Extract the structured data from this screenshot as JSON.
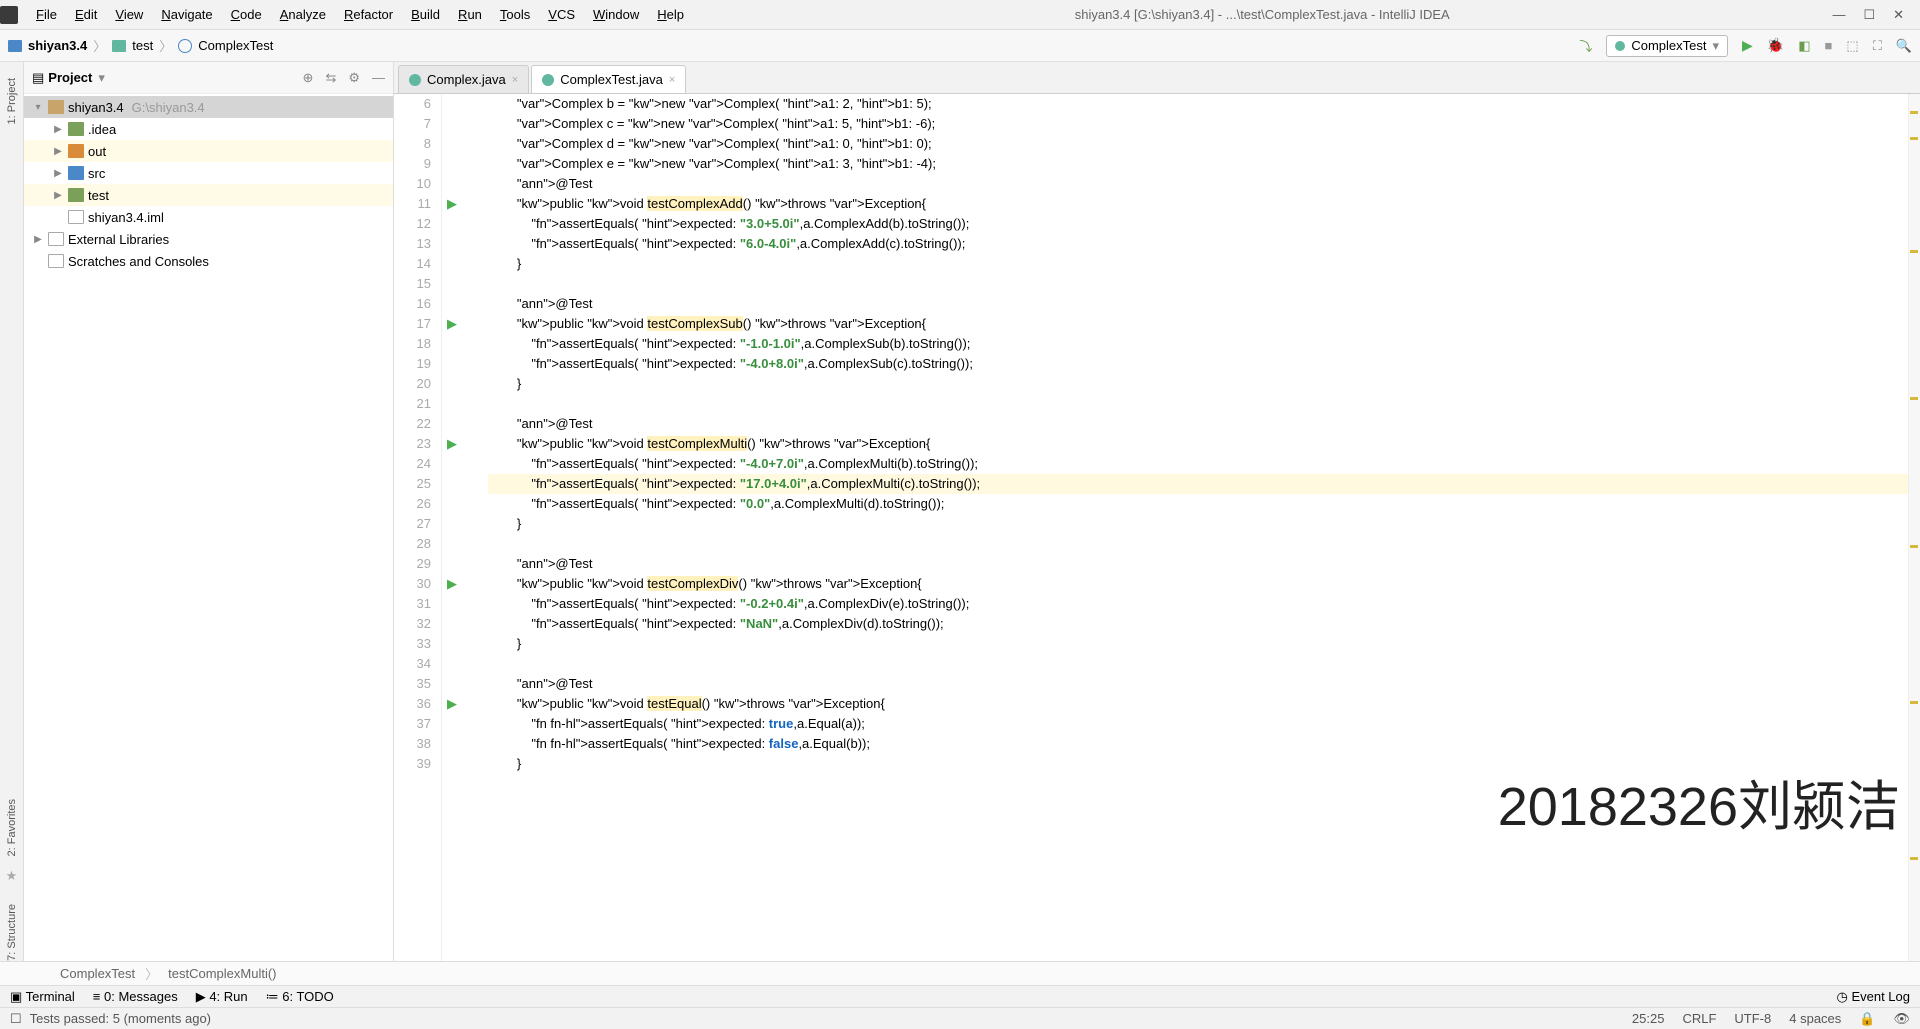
{
  "window": {
    "title": "shiyan3.4 [G:\\shiyan3.4] - ...\\test\\ComplexTest.java - IntelliJ IDEA"
  },
  "menu": [
    "File",
    "Edit",
    "View",
    "Navigate",
    "Code",
    "Analyze",
    "Refactor",
    "Build",
    "Run",
    "Tools",
    "VCS",
    "Window",
    "Help"
  ],
  "breadcrumb": {
    "root": "shiyan3.4",
    "folder": "test",
    "class": "ComplexTest"
  },
  "runconfig": {
    "name": "ComplexTest"
  },
  "project_panel": {
    "title": "Project",
    "tree": [
      {
        "depth": 0,
        "icon": "folder",
        "label": "shiyan3.4",
        "path": "G:\\shiyan3.4",
        "expanded": true,
        "sel": true
      },
      {
        "depth": 1,
        "icon": "folder-g",
        "label": ".idea",
        "arrow": "▶"
      },
      {
        "depth": 1,
        "icon": "folder-o",
        "label": "out",
        "arrow": "▶",
        "yel": true
      },
      {
        "depth": 1,
        "icon": "folder-b",
        "label": "src",
        "arrow": "▶"
      },
      {
        "depth": 1,
        "icon": "folder-g",
        "label": "test",
        "arrow": "▶",
        "yel": true
      },
      {
        "depth": 1,
        "icon": "file",
        "label": "shiyan3.4.iml"
      },
      {
        "depth": 0,
        "icon": "file",
        "label": "External Libraries",
        "arrow": "▶"
      },
      {
        "depth": 0,
        "icon": "file",
        "label": "Scratches and Consoles"
      }
    ]
  },
  "tabs": [
    {
      "label": "Complex.java",
      "active": false
    },
    {
      "label": "ComplexTest.java",
      "active": true
    }
  ],
  "code": {
    "first_line": 6,
    "lines": [
      {
        "n": 6,
        "t": "Complex b = new Complex( a1: 2, b1: 5);",
        "kind": "decl"
      },
      {
        "n": 7,
        "t": "Complex c = new Complex( a1: 5, b1: -6);",
        "kind": "decl"
      },
      {
        "n": 8,
        "t": "Complex d = new Complex( a1: 0, b1: 0);",
        "kind": "decl"
      },
      {
        "n": 9,
        "t": "Complex e = new Complex( a1: 3, b1: -4);",
        "kind": "decl"
      },
      {
        "n": 10,
        "t": "@Test",
        "kind": "ann"
      },
      {
        "n": 11,
        "t": "public void testComplexAdd() throws Exception{",
        "run": true,
        "hlname": "testComplexAdd"
      },
      {
        "n": 12,
        "t": "    assertEquals( expected: \"3.0+5.0i\",a.ComplexAdd(b).toString());"
      },
      {
        "n": 13,
        "t": "    assertEquals( expected: \"6.0-4.0i\",a.ComplexAdd(c).toString());"
      },
      {
        "n": 14,
        "t": "}"
      },
      {
        "n": 15,
        "t": ""
      },
      {
        "n": 16,
        "t": "@Test",
        "kind": "ann"
      },
      {
        "n": 17,
        "t": "public void testComplexSub() throws Exception{",
        "run": true,
        "hlname": "testComplexSub"
      },
      {
        "n": 18,
        "t": "    assertEquals( expected: \"-1.0-1.0i\",a.ComplexSub(b).toString());"
      },
      {
        "n": 19,
        "t": "    assertEquals( expected: \"-4.0+8.0i\",a.ComplexSub(c).toString());"
      },
      {
        "n": 20,
        "t": "}"
      },
      {
        "n": 21,
        "t": ""
      },
      {
        "n": 22,
        "t": "@Test",
        "kind": "ann"
      },
      {
        "n": 23,
        "t": "public void testComplexMulti() throws Exception{",
        "run": true,
        "hlname": "testComplexMulti"
      },
      {
        "n": 24,
        "t": "    assertEquals( expected: \"-4.0+7.0i\",a.ComplexMulti(b).toString());"
      },
      {
        "n": 25,
        "t": "    assertEquals( expected: \"17.0+4.0i\",a.ComplexMulti(c).toString());",
        "cur": true
      },
      {
        "n": 26,
        "t": "    assertEquals( expected: \"0.0\",a.ComplexMulti(d).toString());"
      },
      {
        "n": 27,
        "t": "}"
      },
      {
        "n": 28,
        "t": ""
      },
      {
        "n": 29,
        "t": "@Test",
        "kind": "ann"
      },
      {
        "n": 30,
        "t": "public void testComplexDiv() throws Exception{",
        "run": true,
        "hlname": "testComplexDiv"
      },
      {
        "n": 31,
        "t": "    assertEquals( expected: \"-0.2+0.4i\",a.ComplexDiv(e).toString());"
      },
      {
        "n": 32,
        "t": "    assertEquals( expected: \"NaN\",a.ComplexDiv(d).toString());"
      },
      {
        "n": 33,
        "t": "}"
      },
      {
        "n": 34,
        "t": ""
      },
      {
        "n": 35,
        "t": "@Test",
        "kind": "ann"
      },
      {
        "n": 36,
        "t": "public void testEqual() throws Exception{",
        "run": true,
        "hlname": "testEqual"
      },
      {
        "n": 37,
        "t": "    assertEquals( expected: true,a.Equal(a));",
        "ay": true
      },
      {
        "n": 38,
        "t": "    assertEquals( expected: false,a.Equal(b));",
        "ay": true
      },
      {
        "n": 39,
        "t": "}"
      }
    ]
  },
  "breadcrumb2": {
    "class": "ComplexTest",
    "method": "testComplexMulti()"
  },
  "bottom": {
    "terminal": "Terminal",
    "messages": "0: Messages",
    "run": "4: Run",
    "todo": "6: TODO",
    "eventlog": "Event Log"
  },
  "status": {
    "msg": "Tests passed: 5 (moments ago)",
    "pos": "25:25",
    "le": "CRLF",
    "enc": "UTF-8",
    "indent": "4 spaces"
  },
  "side_tools": {
    "project": "1: Project",
    "favorites": "2: Favorites",
    "structure": "7: Structure"
  },
  "watermark": "20182326刘颍洁"
}
